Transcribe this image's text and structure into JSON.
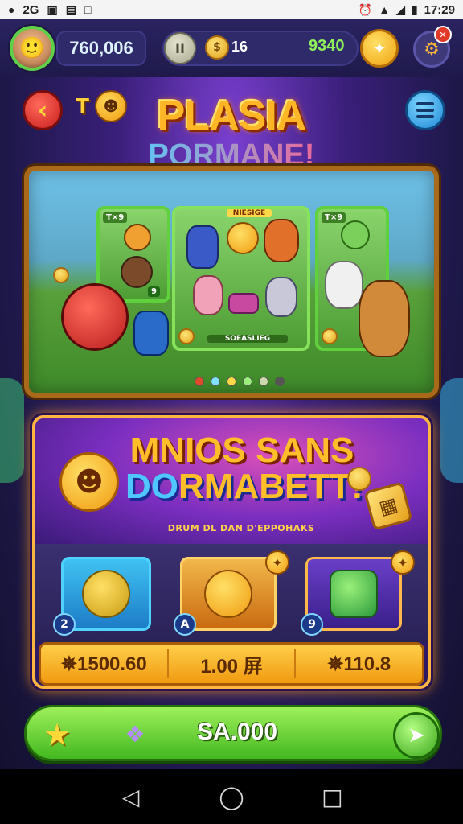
{
  "status_bar": {
    "left_icons": [
      "notification-icon",
      "sim-icon",
      "gallery-icon",
      "briefcase-icon",
      "chat-icon"
    ],
    "left_text": "2G",
    "time": "17:29"
  },
  "hud": {
    "coins": "760,006",
    "pause_label": "II",
    "gems": "16",
    "gold": "9340"
  },
  "header": {
    "to_label": "T",
    "title_line1": "PLASIA",
    "title_line2": "PORMANE!"
  },
  "carousel": {
    "card_left_tag": "T×9",
    "card_left_count": "9",
    "card_right_tag": "T×9",
    "mid_banner": "NIESIGE",
    "mid_caption": "SOEASLIEG",
    "dots": 6
  },
  "promo": {
    "title_line1": "MNIOS SANS",
    "title_line2_a": "DO",
    "title_line2_b": "RMABETT!",
    "subtitle": "DRUM DL DAN D'EPPOHAKS",
    "badges": [
      "2",
      "A",
      "9"
    ],
    "prices": [
      "✵1500.60",
      "1.00 屏",
      "✵110.8"
    ]
  },
  "action_bar": {
    "label": "SA.000"
  },
  "colors": {
    "accent_gold": "#ffbe2a",
    "action_green": "#43b820",
    "panel_purple": "#3a1a78"
  }
}
